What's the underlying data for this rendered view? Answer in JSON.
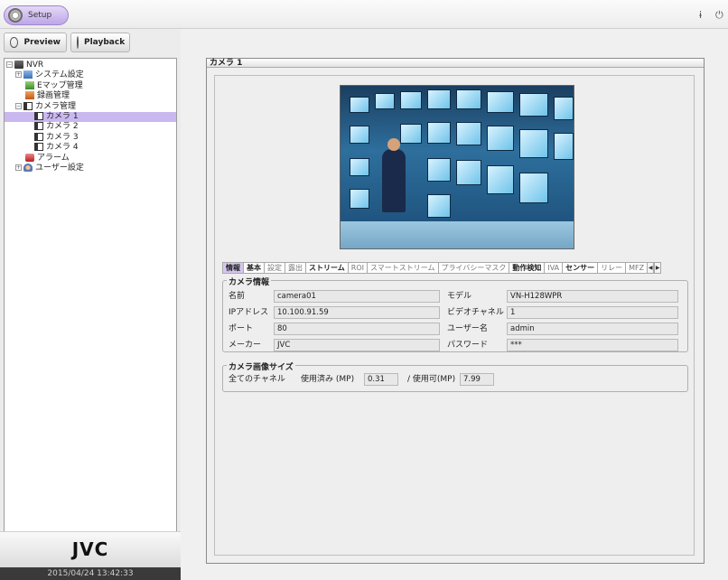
{
  "topbar": {
    "setup_label": "Setup"
  },
  "modes": {
    "preview": "Preview",
    "playback": "Playback"
  },
  "tree": {
    "nvr": "NVR",
    "system": "システム設定",
    "emap": "Eマップ管理",
    "recording": "録画管理",
    "camera_mgmt": "カメラ管理",
    "cameras": [
      "カメラ 1",
      "カメラ 2",
      "カメラ 3",
      "カメラ 4"
    ],
    "alarm": "アラーム",
    "user": "ユーザー設定"
  },
  "brand": {
    "logo": "JVC",
    "datetime": "2015/04/24 13:42:33"
  },
  "main": {
    "title": "カメラ 1",
    "tabs": [
      "情報",
      "基本",
      "設定",
      "露出",
      "ストリーム",
      "ROI",
      "スマートストリーム",
      "プライバシーマスク",
      "動作検知",
      "IVA",
      "センサー",
      "リレー",
      "MFZ"
    ],
    "info": {
      "group_title": "カメラ情報",
      "name_label": "名前",
      "name_value": "camera01",
      "ip_label": "IPアドレス",
      "ip_value": "10.100.91.59",
      "port_label": "ポート",
      "port_value": "80",
      "maker_label": "メーカー",
      "maker_value": "JVC",
      "model_label": "モデル",
      "model_value": "VN-H128WPR",
      "vch_label": "ビデオチャネル",
      "vch_value": "1",
      "user_label": "ユーザー名",
      "user_value": "admin",
      "pass_label": "パスワード",
      "pass_value": "***"
    },
    "size": {
      "group_title": "カメラ画像サイズ",
      "all_label": "全てのチャネル",
      "used_label": "使用済み (MP)",
      "used_value": "0.31",
      "avail_label": "/ 使用可(MP)",
      "avail_value": "7.99"
    }
  }
}
